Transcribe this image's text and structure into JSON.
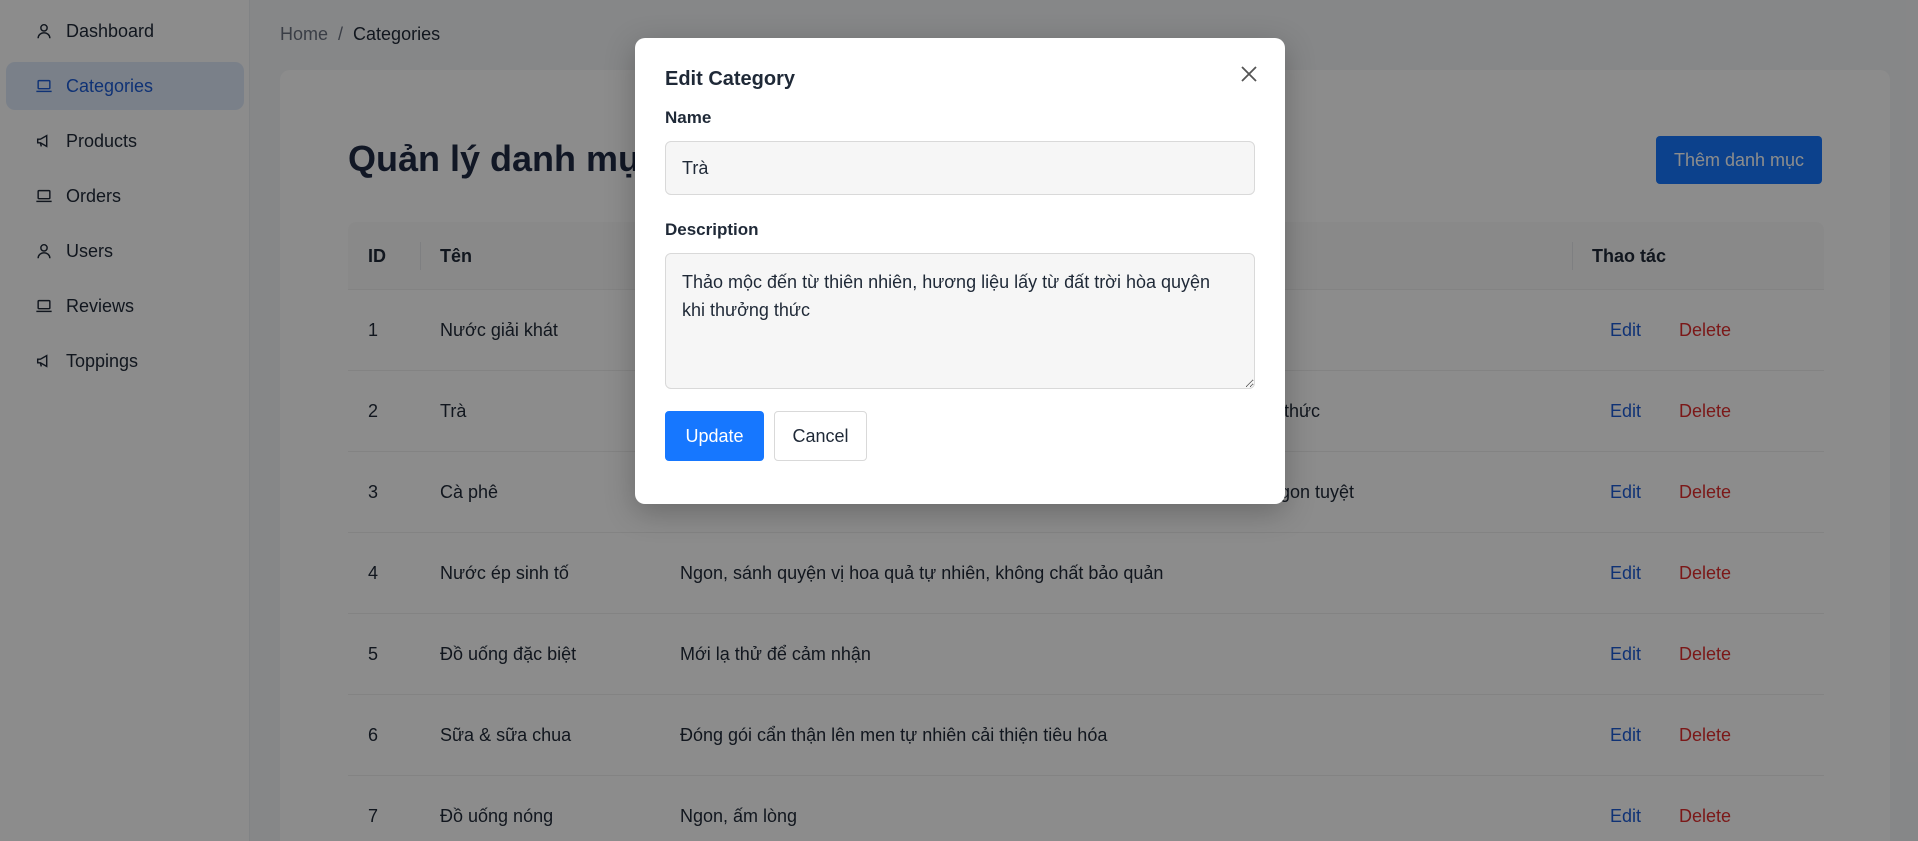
{
  "sidebar": {
    "items": [
      {
        "label": "Dashboard",
        "icon": "user-icon"
      },
      {
        "label": "Categories",
        "icon": "laptop-icon",
        "active": true
      },
      {
        "label": "Products",
        "icon": "megaphone-icon"
      },
      {
        "label": "Orders",
        "icon": "laptop-icon"
      },
      {
        "label": "Users",
        "icon": "user-icon"
      },
      {
        "label": "Reviews",
        "icon": "laptop-icon"
      },
      {
        "label": "Toppings",
        "icon": "megaphone-icon"
      }
    ]
  },
  "breadcrumb": {
    "home": "Home",
    "separator": "/",
    "current": "Categories"
  },
  "page": {
    "title": "Quản lý danh mục",
    "add_button": "Thêm danh mục"
  },
  "table": {
    "headers": {
      "id": "ID",
      "name": "Tên",
      "actions": "Thao tác"
    },
    "edit_label": "Edit",
    "delete_label": "Delete",
    "rows": [
      {
        "id": "1",
        "name": "Nước giải khát",
        "description": ""
      },
      {
        "id": "2",
        "name": "Trà",
        "description": "thức"
      },
      {
        "id": "3",
        "name": "Cà phê",
        "description": "gon tuyệt"
      },
      {
        "id": "4",
        "name": "Nước ép sinh tố",
        "description": "Ngon, sánh quyện vị hoa quả tự nhiên, không chất bảo quản"
      },
      {
        "id": "5",
        "name": "Đồ uống đặc biệt",
        "description": "Mới lạ thử để cảm nhận"
      },
      {
        "id": "6",
        "name": "Sữa & sữa chua",
        "description": "Đóng gói cẩn thận lên men tự nhiên cải thiện tiêu hóa"
      },
      {
        "id": "7",
        "name": "Đồ uống nóng",
        "description": "Ngon, ấm lòng"
      }
    ]
  },
  "modal": {
    "title": "Edit Category",
    "name_label": "Name",
    "name_value": "Trà",
    "description_label": "Description",
    "description_value": "Thảo mộc đến từ thiên nhiên, hương liệu lấy từ đất trời hòa quyện khi thưởng thức",
    "update_label": "Update",
    "cancel_label": "Cancel"
  },
  "colors": {
    "primary": "#1677ff",
    "active_nav_bg": "#dfeaf9",
    "link_edit": "#1c5bd6",
    "link_delete": "#e02d2d"
  }
}
